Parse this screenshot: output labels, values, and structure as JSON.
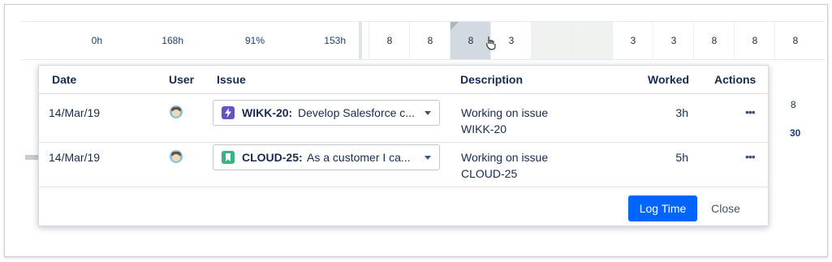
{
  "grid": {
    "summary": [
      "0h",
      "168h",
      "91%",
      "153h"
    ],
    "days": [
      "8",
      "8",
      "8",
      "3",
      "",
      "",
      "3",
      "3",
      "8",
      "8",
      "8"
    ],
    "row2_value": "8",
    "row3_value": "30"
  },
  "popup": {
    "columns": {
      "date": "Date",
      "user": "User",
      "issue": "Issue",
      "description": "Description",
      "worked": "Worked",
      "actions": "Actions"
    },
    "rows": [
      {
        "date": "14/Mar/19",
        "issue_key": "WIKK-20:",
        "issue_summary": "Develop Salesforce c...",
        "issue_type_icon": "lightning-epic-icon",
        "issue_color": "#6554c0",
        "description_line1": "Working on issue",
        "description_line2": "WIKK-20",
        "worked": "3h",
        "actions_icon": "ellipsis-icon"
      },
      {
        "date": "14/Mar/19",
        "issue_key": "CLOUD-25:",
        "issue_summary": "As a customer I ca...",
        "issue_type_icon": "bookmark-story-icon",
        "issue_color": "#36b37e",
        "description_line1": "Working on issue",
        "description_line2": "CLOUD-25",
        "worked": "5h",
        "actions_icon": "ellipsis-icon"
      }
    ],
    "log_time_label": "Log Time",
    "close_label": "Close"
  },
  "colors": {
    "primary": "#0065ff",
    "selected_cell": "#d3d9e0"
  }
}
